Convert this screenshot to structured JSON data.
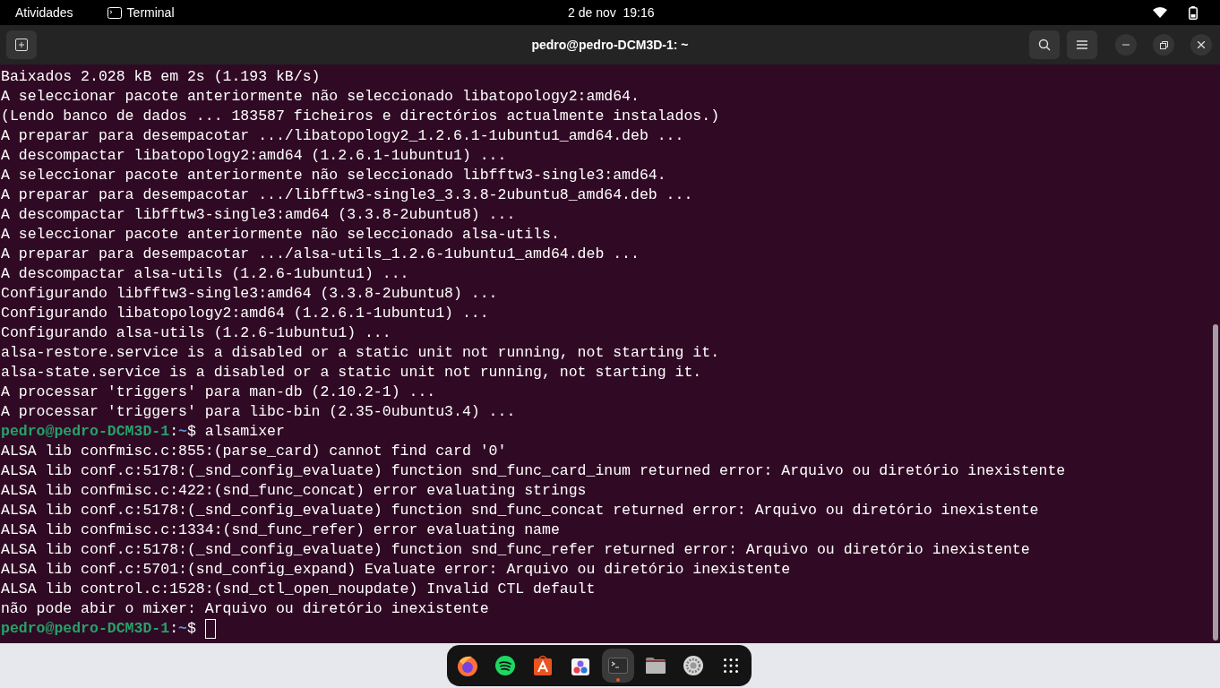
{
  "top_bar": {
    "activities": "Atividades",
    "app_name": "Terminal",
    "date": "2 de nov",
    "time": "19:16"
  },
  "window": {
    "title": "pedro@pedro-DCM3D-1: ~"
  },
  "terminal": {
    "lines": [
      {
        "kind": "output",
        "text": "Baixados 2.028 kB em 2s (1.193 kB/s)"
      },
      {
        "kind": "output",
        "text": "A seleccionar pacote anteriormente não seleccionado libatopology2:amd64."
      },
      {
        "kind": "output",
        "text": "(Lendo banco de dados ... 183587 ficheiros e directórios actualmente instalados.)"
      },
      {
        "kind": "output",
        "text": "A preparar para desempacotar .../libatopology2_1.2.6.1-1ubuntu1_amd64.deb ..."
      },
      {
        "kind": "output",
        "text": "A descompactar libatopology2:amd64 (1.2.6.1-1ubuntu1) ..."
      },
      {
        "kind": "output",
        "text": "A seleccionar pacote anteriormente não seleccionado libfftw3-single3:amd64."
      },
      {
        "kind": "output",
        "text": "A preparar para desempacotar .../libfftw3-single3_3.3.8-2ubuntu8_amd64.deb ..."
      },
      {
        "kind": "output",
        "text": "A descompactar libfftw3-single3:amd64 (3.3.8-2ubuntu8) ..."
      },
      {
        "kind": "output",
        "text": "A seleccionar pacote anteriormente não seleccionado alsa-utils."
      },
      {
        "kind": "output",
        "text": "A preparar para desempacotar .../alsa-utils_1.2.6-1ubuntu1_amd64.deb ..."
      },
      {
        "kind": "output",
        "text": "A descompactar alsa-utils (1.2.6-1ubuntu1) ..."
      },
      {
        "kind": "output",
        "text": "Configurando libfftw3-single3:amd64 (3.3.8-2ubuntu8) ..."
      },
      {
        "kind": "output",
        "text": "Configurando libatopology2:amd64 (1.2.6.1-1ubuntu1) ..."
      },
      {
        "kind": "output",
        "text": "Configurando alsa-utils (1.2.6-1ubuntu1) ..."
      },
      {
        "kind": "output",
        "text": "alsa-restore.service is a disabled or a static unit not running, not starting it."
      },
      {
        "kind": "output",
        "text": "alsa-state.service is a disabled or a static unit not running, not starting it."
      },
      {
        "kind": "output",
        "text": "A processar 'triggers' para man-db (2.10.2-1) ..."
      },
      {
        "kind": "output",
        "text": "A processar 'triggers' para libc-bin (2.35-0ubuntu3.4) ..."
      },
      {
        "kind": "prompt",
        "user": "pedro@pedro-DCM3D-1",
        "sep": ":",
        "path": "~",
        "symbol": "$",
        "command": "alsamixer"
      },
      {
        "kind": "output",
        "text": "ALSA lib confmisc.c:855:(parse_card) cannot find card '0'"
      },
      {
        "kind": "output",
        "text": "ALSA lib conf.c:5178:(_snd_config_evaluate) function snd_func_card_inum returned error: Arquivo ou diretório inexistente"
      },
      {
        "kind": "output",
        "text": "ALSA lib confmisc.c:422:(snd_func_concat) error evaluating strings"
      },
      {
        "kind": "output",
        "text": "ALSA lib conf.c:5178:(_snd_config_evaluate) function snd_func_concat returned error: Arquivo ou diretório inexistente"
      },
      {
        "kind": "output",
        "text": "ALSA lib confmisc.c:1334:(snd_func_refer) error evaluating name"
      },
      {
        "kind": "output",
        "text": "ALSA lib conf.c:5178:(_snd_config_evaluate) function snd_func_refer returned error: Arquivo ou diretório inexistente"
      },
      {
        "kind": "output",
        "text": "ALSA lib conf.c:5701:(snd_config_expand) Evaluate error: Arquivo ou diretório inexistente"
      },
      {
        "kind": "output",
        "text": "ALSA lib control.c:1528:(snd_ctl_open_noupdate) Invalid CTL default"
      },
      {
        "kind": "output",
        "text": "não pode abir o mixer: Arquivo ou diretório inexistente"
      },
      {
        "kind": "prompt",
        "user": "pedro@pedro-DCM3D-1",
        "sep": ":",
        "path": "~",
        "symbol": "$",
        "cursor": true
      }
    ]
  },
  "dock": {
    "items": [
      {
        "kind": "browser",
        "selected": false,
        "running": false
      },
      {
        "kind": "music",
        "selected": false,
        "running": false
      },
      {
        "kind": "store",
        "selected": false,
        "running": false
      },
      {
        "kind": "shapes",
        "selected": false,
        "running": false
      },
      {
        "kind": "terminal",
        "selected": true,
        "running": true
      },
      {
        "kind": "folder",
        "selected": false,
        "running": false
      },
      {
        "kind": "settings",
        "selected": false,
        "running": false
      },
      {
        "kind": "grid",
        "selected": false,
        "running": false
      }
    ]
  }
}
